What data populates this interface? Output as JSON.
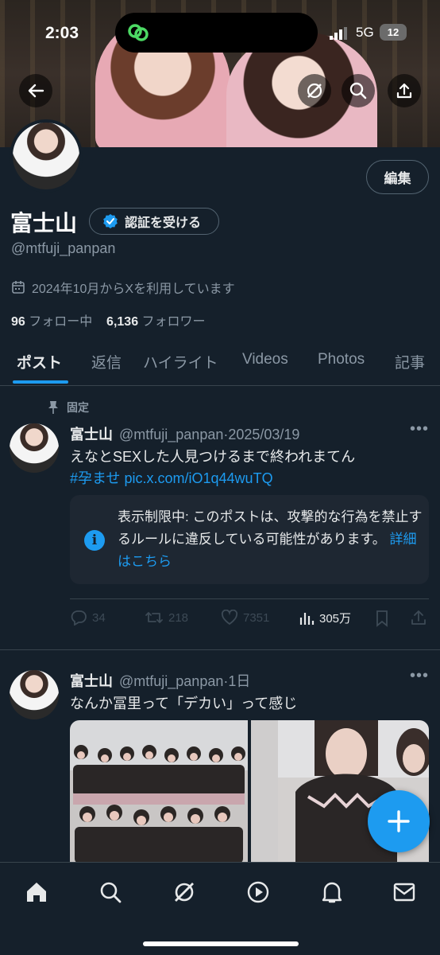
{
  "status_bar": {
    "time": "2:03",
    "network": "5G",
    "battery": "12"
  },
  "profile": {
    "edit_label": "編集",
    "name": "富士山",
    "verify_label": "認証を受ける",
    "handle": "@mtfuji_panpan",
    "joined": "2024年10月からXを利用しています",
    "following_count": "96",
    "following_label": "フォロー中",
    "followers_count": "6,136",
    "followers_label": "フォロワー"
  },
  "tabs": [
    "ポスト",
    "返信",
    "ハイライト",
    "Videos",
    "Photos",
    "記事"
  ],
  "pinned_label": "固定",
  "posts": [
    {
      "name": "富士山",
      "handle": "@mtfuji_panpan",
      "date": "2025/03/19",
      "text": "えなとSEXした人見つけるまで終われまてん",
      "hashtag": "#孕ませ",
      "link": "pic.x.com/iO1q44wuTQ",
      "notice_text": "表示制限中: このポストは、攻撃的な行為を禁止するルールに違反している可能性があります。",
      "notice_link": "詳細はこちら",
      "replies": "34",
      "reposts": "218",
      "likes": "7351",
      "views": "305万"
    },
    {
      "name": "富士山",
      "handle": "@mtfuji_panpan",
      "date": "1日",
      "text": "なんか冨里って「デカい」って感じ"
    }
  ],
  "icons": {
    "back": "back-arrow-icon",
    "grok": "grok-icon",
    "search": "search-icon",
    "share": "share-icon",
    "calendar": "calendar-icon",
    "pin": "pin-icon",
    "info": "info-icon",
    "home": "home-icon",
    "video": "play-icon",
    "notifications": "bell-icon",
    "messages": "mail-icon"
  },
  "colors": {
    "accent": "#1d9bf0",
    "background": "#15202b",
    "battery_low": "#e0443e"
  }
}
